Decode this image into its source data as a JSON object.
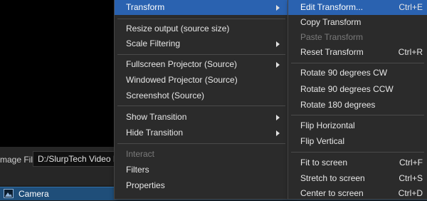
{
  "properties": {
    "image_file_label": "mage File",
    "image_file_value": "D:/SlurpTech Video Me"
  },
  "source_row": {
    "name": "Camera"
  },
  "context_menu": {
    "items": [
      {
        "label": "Transform"
      },
      {
        "label": "Resize output (source size)"
      },
      {
        "label": "Scale Filtering"
      },
      {
        "label": "Fullscreen Projector (Source)"
      },
      {
        "label": "Windowed Projector (Source)"
      },
      {
        "label": "Screenshot (Source)"
      },
      {
        "label": "Show Transition"
      },
      {
        "label": "Hide Transition"
      },
      {
        "label": "Interact"
      },
      {
        "label": "Filters"
      },
      {
        "label": "Properties"
      }
    ]
  },
  "transform_menu": {
    "items": [
      {
        "label": "Edit Transform...",
        "shortcut": "Ctrl+E"
      },
      {
        "label": "Copy Transform",
        "shortcut": ""
      },
      {
        "label": "Paste Transform",
        "shortcut": ""
      },
      {
        "label": "Reset Transform",
        "shortcut": "Ctrl+R"
      },
      {
        "label": "Rotate 90 degrees CW",
        "shortcut": ""
      },
      {
        "label": "Rotate 90 degrees CCW",
        "shortcut": ""
      },
      {
        "label": "Rotate 180 degrees",
        "shortcut": ""
      },
      {
        "label": "Flip Horizontal",
        "shortcut": ""
      },
      {
        "label": "Flip Vertical",
        "shortcut": ""
      },
      {
        "label": "Fit to screen",
        "shortcut": "Ctrl+F"
      },
      {
        "label": "Stretch to screen",
        "shortcut": "Ctrl+S"
      },
      {
        "label": "Center to screen",
        "shortcut": "Ctrl+D"
      }
    ]
  },
  "colors": {
    "highlight": "#2a62b0",
    "menu_bg": "#2b2b2b",
    "selected_row": "#1f4e79"
  }
}
